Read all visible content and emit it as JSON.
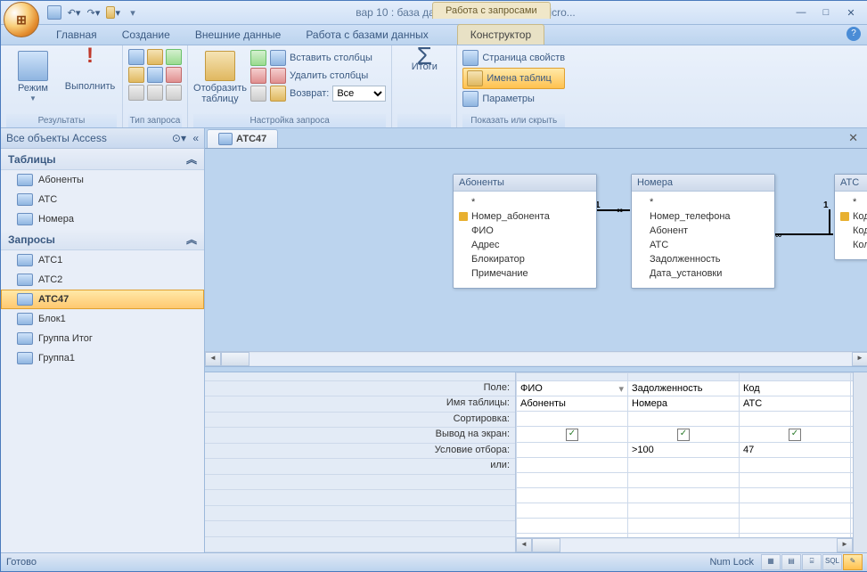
{
  "title": "вар 10 : база данных (Access 2007) - Micro...",
  "context_tab": "Работа с запросами",
  "tabs": {
    "home": "Главная",
    "create": "Создание",
    "external": "Внешние данные",
    "dbtools": "Работа с базами данных",
    "design": "Конструктор"
  },
  "ribbon": {
    "results": {
      "view": "Режим",
      "run": "Выполнить",
      "label": "Результаты"
    },
    "qtype": {
      "label": "Тип запроса"
    },
    "setup": {
      "showtable": "Отобразить\nтаблицу",
      "insertcols": "Вставить столбцы",
      "deletecols": "Удалить столбцы",
      "return": "Возврат:",
      "return_val": "Все",
      "label": "Настройка запроса"
    },
    "totals": {
      "label": "Итоги"
    },
    "showhide": {
      "propsheet": "Страница свойств",
      "tablenames": "Имена таблиц",
      "params": "Параметры",
      "label": "Показать или скрыть"
    }
  },
  "nav": {
    "title": "Все объекты Access",
    "sections": {
      "tables": "Таблицы",
      "queries": "Запросы"
    },
    "tables": [
      "Абоненты",
      "АТС",
      "Номера"
    ],
    "queries": [
      "АТС1",
      "АТС2",
      "АТС47",
      "Блок1",
      "Группа Итог",
      "Группа1"
    ],
    "selected": "АТС47"
  },
  "doc": {
    "tab": "АТС47"
  },
  "designer": {
    "tables": [
      {
        "name": "Абоненты",
        "fields": [
          "*",
          "Номер_абонента",
          "ФИО",
          "Адрес",
          "Блокиратор",
          "Примечание"
        ],
        "key": 1
      },
      {
        "name": "Номера",
        "fields": [
          "*",
          "Номер_телефона",
          "Абонент",
          "АТС",
          "Задолженность",
          "Дата_установки"
        ]
      },
      {
        "name": "АТС",
        "fields": [
          "*",
          "Код",
          "Код района",
          "Количество номеров"
        ],
        "key": 1
      }
    ],
    "rel": [
      "1",
      "∞",
      "∞",
      "1"
    ]
  },
  "grid": {
    "labels": {
      "field": "Поле:",
      "table": "Имя таблицы:",
      "sort": "Сортировка:",
      "show": "Вывод на экран:",
      "criteria": "Условие отбора:",
      "or": "или:"
    },
    "cols": [
      {
        "field": "ФИО",
        "table": "Абоненты",
        "show": true,
        "criteria": ""
      },
      {
        "field": "Задолженность",
        "table": "Номера",
        "show": true,
        "criteria": ">100"
      },
      {
        "field": "Код",
        "table": "АТС",
        "show": true,
        "criteria": "47"
      },
      {
        "field": "",
        "table": "",
        "show": false,
        "criteria": ""
      },
      {
        "field": "",
        "table": "",
        "show": false,
        "criteria": ""
      }
    ]
  },
  "status": {
    "ready": "Готово",
    "numlock": "Num Lock",
    "sql": "SQL"
  }
}
